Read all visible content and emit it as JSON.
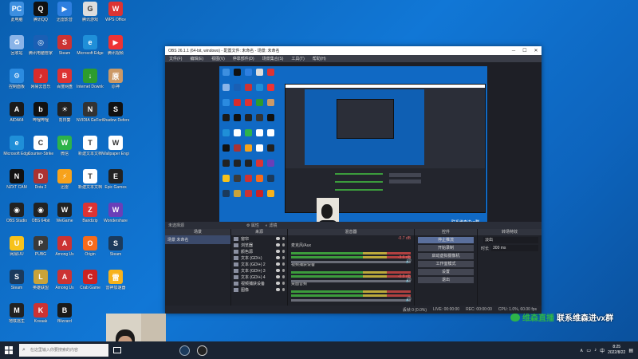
{
  "desktop": {
    "icons": [
      {
        "label": "此电脑",
        "color": "#3d8fe0",
        "glyph": "PC"
      },
      {
        "label": "腾讯QQ",
        "color": "#111",
        "glyph": "Q"
      },
      {
        "label": "迅雷影音",
        "color": "#2e7fe0",
        "glyph": "▶"
      },
      {
        "label": "腾讯游戏",
        "color": "#ddd",
        "glyph": "G"
      },
      {
        "label": "WPS Office",
        "color": "#d33",
        "glyph": "W"
      },
      {
        "label": "回收站",
        "color": "#8ab4e8",
        "glyph": "♻"
      },
      {
        "label": "腾讯电脑管家",
        "color": "#1a5fb4",
        "glyph": "◎"
      },
      {
        "label": "Steam",
        "color": "#c33",
        "glyph": "S"
      },
      {
        "label": "Microsoft Edge",
        "color": "#1f8fd8",
        "glyph": "e"
      },
      {
        "label": "腾讯视频",
        "color": "#e33",
        "glyph": "▶"
      },
      {
        "label": "控制面板",
        "color": "#2b8be0",
        "glyph": "⚙"
      },
      {
        "label": "网易云音乐",
        "color": "#d92c2c",
        "glyph": "♪"
      },
      {
        "label": "百度网盘",
        "color": "#d33",
        "glyph": "B"
      },
      {
        "label": "Internet Download",
        "color": "#2d9c2d",
        "glyph": "↓"
      },
      {
        "label": "原神",
        "color": "#c96",
        "glyph": "原"
      },
      {
        "label": "AIDA64",
        "color": "#1a1a1a",
        "glyph": "A"
      },
      {
        "label": "哔哩哔哩",
        "color": "#111",
        "glyph": "b"
      },
      {
        "label": "向日葵",
        "color": "#222",
        "glyph": "☀"
      },
      {
        "label": "NVIDIA GeForce",
        "color": "#333",
        "glyph": "N"
      },
      {
        "label": "Shadow Defender",
        "color": "#111",
        "glyph": "S"
      },
      {
        "label": "Microsoft Edge",
        "color": "#1f8fd8",
        "glyph": "e"
      },
      {
        "label": "Counter-Strike",
        "color": "#fff",
        "glyph": "C"
      },
      {
        "label": "微信",
        "color": "#2db34a",
        "glyph": "W"
      },
      {
        "label": "新建文本文档",
        "color": "#fff",
        "glyph": "T"
      },
      {
        "label": "Wallpaper Engine",
        "color": "#fff",
        "glyph": "W"
      },
      {
        "label": "NZXT CAM",
        "color": "#111",
        "glyph": "N"
      },
      {
        "label": "Dota 2",
        "color": "#a33",
        "glyph": "D"
      },
      {
        "label": "迅雷",
        "color": "#f7a21b",
        "glyph": "⚡"
      },
      {
        "label": "新建文本文档",
        "color": "#fff",
        "glyph": "T"
      },
      {
        "label": "Epic Games",
        "color": "#222",
        "glyph": "E"
      },
      {
        "label": "OBS Studio",
        "color": "#222",
        "glyph": "◉"
      },
      {
        "label": "OBS 64bit",
        "color": "#222",
        "glyph": "◉"
      },
      {
        "label": "WeGame",
        "color": "#222",
        "glyph": "W"
      },
      {
        "label": "Bandizip",
        "color": "#d33",
        "glyph": "Z"
      },
      {
        "label": "Wondershare",
        "color": "#6a3fb8",
        "glyph": "W"
      },
      {
        "label": "网易UU",
        "color": "#f7c21b",
        "glyph": "U"
      },
      {
        "label": "PUBG",
        "color": "#3a3a3a",
        "glyph": "P"
      },
      {
        "label": "Among Us",
        "color": "#c33",
        "glyph": "A"
      },
      {
        "label": "Origin",
        "color": "#f76b1b",
        "glyph": "O"
      },
      {
        "label": "Steam",
        "color": "#1b3a5c",
        "glyph": "S"
      },
      {
        "label": "Steam",
        "color": "#1b3a5c",
        "glyph": "S"
      },
      {
        "label": "英雄联盟",
        "color": "#c9a33a",
        "glyph": "L"
      },
      {
        "label": "Among Us",
        "color": "#c33",
        "glyph": "A"
      },
      {
        "label": "Crab Game",
        "color": "#c22",
        "glyph": "C"
      },
      {
        "label": "雷神加速器",
        "color": "#f7b21b",
        "glyph": "雷"
      },
      {
        "label": "地铁逃生",
        "color": "#222",
        "glyph": "M"
      },
      {
        "label": "Kovaak",
        "color": "#c33",
        "glyph": "K"
      },
      {
        "label": "Blizzard",
        "color": "#1a1a1a",
        "glyph": "B"
      }
    ]
  },
  "obs": {
    "title": "OBS 26.1.1 (64-bit, windows) - 配置文件: 未命名 - 场景: 未命名",
    "menus": [
      "文件(F)",
      "编辑(E)",
      "视图(V)",
      "停靠部件(D)",
      "场景集合(S)",
      "工具(T)",
      "帮助(H)"
    ],
    "no_source_label": "未选择源",
    "properties_label": "属性",
    "filters_label": "滤镜",
    "canvas_watermark": "联系维森进vx群",
    "docks": {
      "scenes": {
        "header": "场景",
        "items": [
          "场景 未命名"
        ]
      },
      "sources": {
        "header": "来源",
        "items": [
          "窗帘",
          "浏览器",
          "颜色源",
          "文本 (GDI+)",
          "文本 (GDI+) 2",
          "文本 (GDI+) 3",
          "文本 (GDI+) 4",
          "视频捕获设备",
          "图像"
        ]
      },
      "mixer": {
        "header": "混音器",
        "tracks": [
          {
            "name": "麦克风/Aux",
            "db": "-0.7 dB"
          },
          {
            "name": "视频捕获设备",
            "db": "-3.6 dB"
          },
          {
            "name": "桌面音频",
            "db": "-0.8 dB"
          }
        ]
      },
      "controls": {
        "header": "控件",
        "buttons": [
          "停止推流",
          "开始录制",
          "启动虚拟摄像机",
          "工作室模式",
          "设置",
          "退出"
        ]
      },
      "transitions": {
        "header": "转场特效",
        "type": "淡出",
        "duration_label": "时长",
        "duration": "300 ms"
      }
    },
    "status": {
      "dropped": "丢帧 0 (0.0%)",
      "live": "LIVE: 00:00:00",
      "rec": "REC: 00:00:00",
      "cpu": "CPU: 1.0%, 60.00 fps"
    }
  },
  "watermark": {
    "prefix": "维森直播",
    "main": "联系维森进vx群"
  },
  "taskbar": {
    "search_placeholder": "在这里输入你要搜索的内容",
    "time": "8:25",
    "date": "2022/8/22"
  }
}
